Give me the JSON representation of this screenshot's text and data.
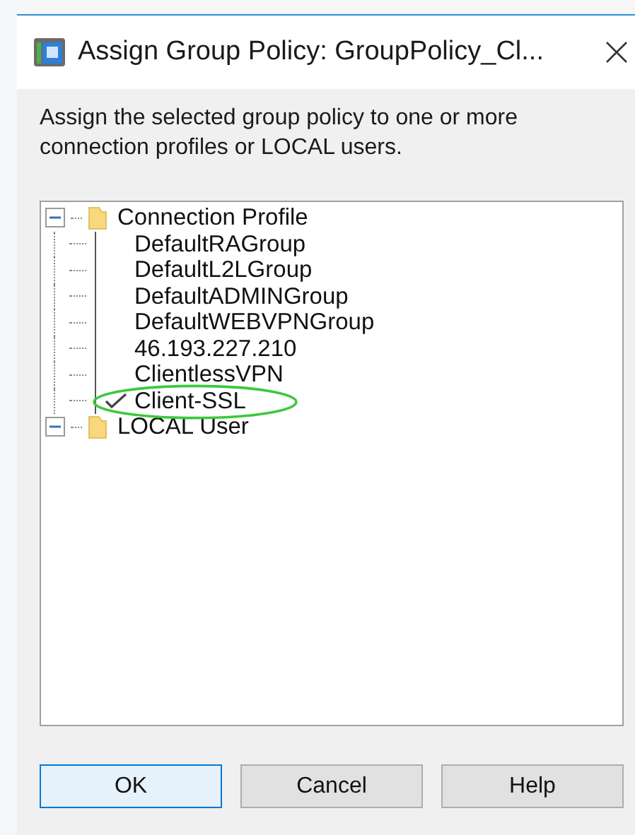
{
  "window": {
    "title": "Assign Group Policy: GroupPolicy_Cl..."
  },
  "instruction": "Assign the selected group policy to one or more connection profiles or LOCAL users.",
  "tree": [
    {
      "label": "Connection Profile",
      "expanded": true,
      "children": [
        {
          "label": "DefaultRAGroup",
          "checked": false
        },
        {
          "label": "DefaultL2LGroup",
          "checked": false
        },
        {
          "label": "DefaultADMINGroup",
          "checked": false
        },
        {
          "label": "DefaultWEBVPNGroup",
          "checked": false
        },
        {
          "label": "46.193.227.210",
          "checked": false
        },
        {
          "label": "ClientlessVPN",
          "checked": false
        },
        {
          "label": "Client-SSL",
          "checked": true
        }
      ]
    },
    {
      "label": "LOCAL User",
      "expanded": true
    }
  ],
  "buttons": [
    {
      "label": "OK",
      "selected": true
    },
    {
      "label": "Cancel",
      "selected": false
    },
    {
      "label": "Help",
      "selected": false
    }
  ]
}
